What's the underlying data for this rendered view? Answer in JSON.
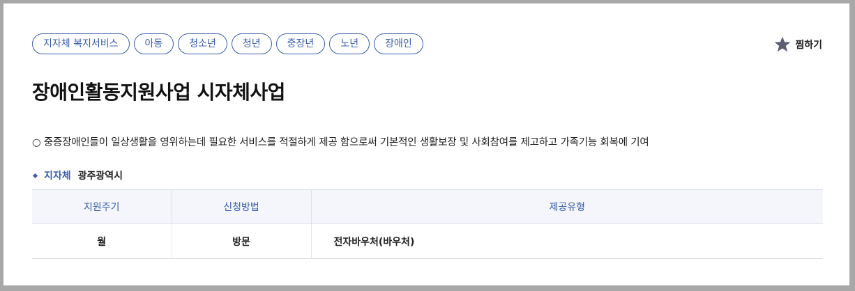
{
  "tags": [
    "지자체 복지서비스",
    "아동",
    "청소년",
    "청년",
    "중장년",
    "노년",
    "장애인"
  ],
  "favorite": {
    "label": "찜하기",
    "icon": "star-icon",
    "icon_color": "#5a5f73"
  },
  "title": "장애인활동지원사업 시자체사업",
  "description": "○ 중증장애인들이 일상생활을 영위하는데 필요한 서비스를 적절하게 제공 함으로써 기본적인 생활보장 및 사회참여를 제고하고 가족기능 회복에 기여",
  "local_gov": {
    "label": "지자체",
    "value": "광주광역시"
  },
  "table": {
    "headers": [
      "지원주기",
      "신청방법",
      "제공유형"
    ],
    "rows": [
      [
        "월",
        "방문",
        "전자바우처(바우처)"
      ]
    ]
  },
  "colors": {
    "accent": "#3a5dae",
    "header_bg": "#f4f6fb"
  }
}
